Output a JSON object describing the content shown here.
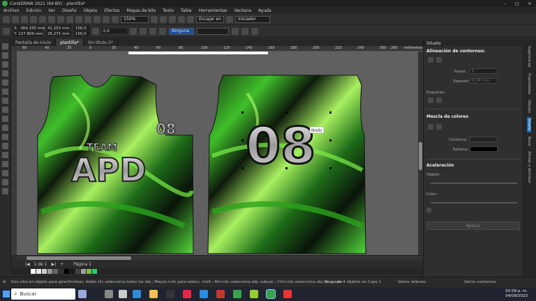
{
  "titlebar": {
    "title": "CorelDRAW 2021 (64-Bit) - plantilla*"
  },
  "window_controls": [
    "–",
    "□",
    "✕"
  ],
  "menu": [
    "Archivo",
    "Edición",
    "Ver",
    "Diseño",
    "Objeto",
    "Efectos",
    "Mapas de bits",
    "Texto",
    "Tabla",
    "Herramientas",
    "Ventana",
    "Ayuda"
  ],
  "toolbar": {
    "zoom": "150%",
    "snap": "Encajar en",
    "launch": "Iniciador"
  },
  "props": {
    "x": "X: -364,335 mm",
    "y": "Y: 127,809 mm",
    "w": "41,253 mm",
    "h": "26,271 mm",
    "sx": "100,0",
    "sy": "100,0",
    "angle": "0,0",
    "outline": "Ninguna"
  },
  "tabs": [
    {
      "label": "Pantalla de inicio"
    },
    {
      "label": "plantilla*"
    },
    {
      "label": "Sin título-1*"
    }
  ],
  "ruler": {
    "ticks": [
      "60",
      "40",
      "20",
      "0",
      "20",
      "40",
      "60",
      "80",
      "100",
      "120",
      "140",
      "160",
      "180",
      "200",
      "220",
      "240",
      "260",
      "280"
    ],
    "unit": "milímetros"
  },
  "design": {
    "team": "TEAM",
    "name": "APD",
    "number_small": "08",
    "number_big": "08",
    "node_label": "Nodo"
  },
  "pagenav": {
    "page": "1 de 1",
    "page_tab": "Página 1"
  },
  "palette_colors": [
    "#ffffff",
    "#e6e6e6",
    "#cccccc",
    "#999999",
    "#666666",
    "#333333",
    "#000000",
    "#1a1a1a",
    "#444444",
    "#a0a0a0",
    "#7bc043",
    "#2ecc71"
  ],
  "status": {
    "hint": "Dos clics en objeto para girar/inclinar; doble clic selecciona todos los obj.; Mayús+clic para selecc. múlt.; Alt+clic selecciona obj. subyac.; Ctrl+clic selecciona obj. de grupo",
    "group": "Grupo de 4 objetos en Capa 1",
    "fill": "Varios rellenos",
    "outline": "Varios contornos"
  },
  "taskbar": {
    "search": "Buscar",
    "time": "02:09 p. m.",
    "date": "04/09/2023"
  },
  "docker": {
    "title": "Silueta",
    "align": "Alineación de contornos:",
    "steps_label": "Pasos:",
    "steps": "1",
    "offset_label": "Separar:",
    "offset": "0,24 mm",
    "corners": "Esquinas:",
    "color_blend": "Mezcla de colores",
    "outline_label": "Contorno:",
    "fill_label": "Relleno:",
    "accel": "Aceleración",
    "object_label": "Objeto:",
    "color_label": "Color:",
    "apply": "Aplicar"
  },
  "sidetabs": [
    "Sugerencias",
    "Propiedades",
    "Objetos",
    "Silueta",
    "Bocel",
    "Alinear y distribuir"
  ]
}
